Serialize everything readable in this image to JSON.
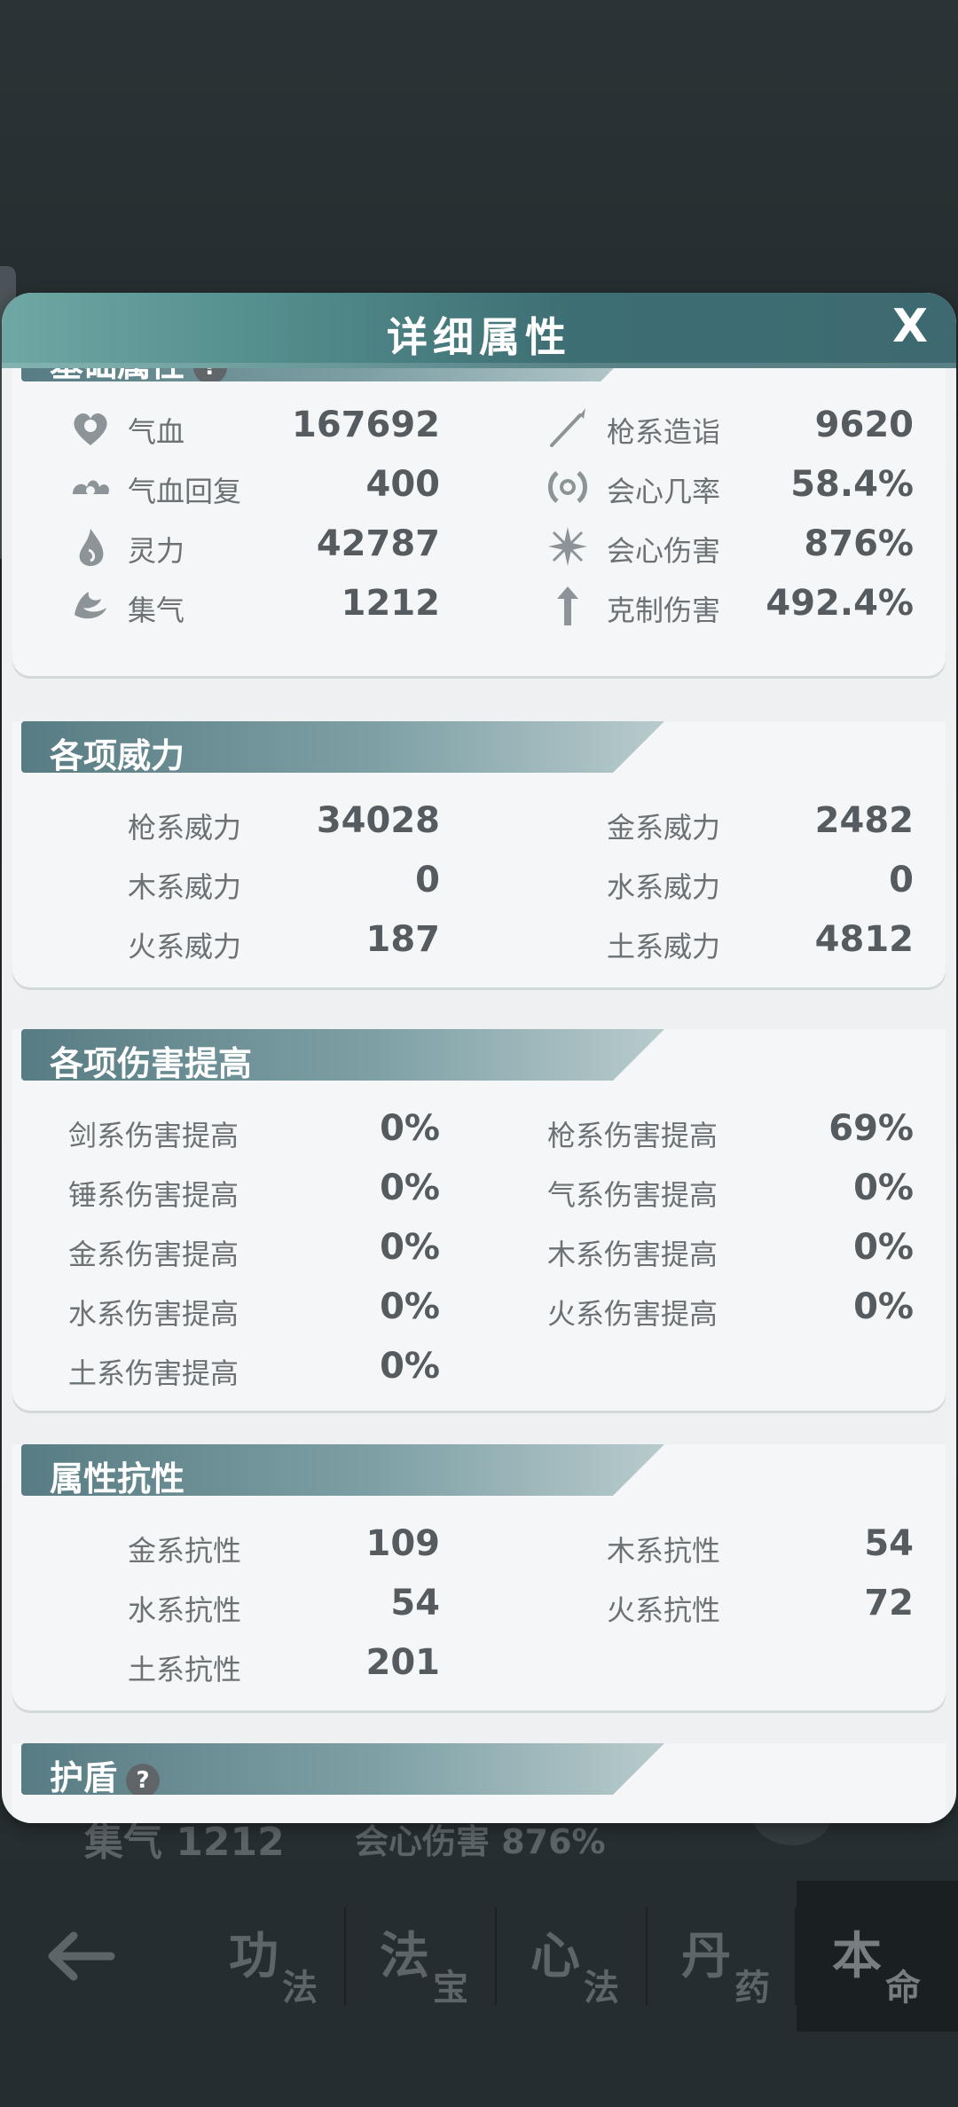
{
  "dialog": {
    "title": "详细属性",
    "close_label": "X"
  },
  "background": {
    "row_label": "集气 1212",
    "row_label2": "会心伤害 876%"
  },
  "basic": {
    "header": "基础属性",
    "help": "?",
    "left": [
      {
        "icon": "blood-icon",
        "label": "气血",
        "value": "167692"
      },
      {
        "icon": "blood-regen-icon",
        "label": "气血回复",
        "value": "400"
      },
      {
        "icon": "spirit-icon",
        "label": "灵力",
        "value": "42787"
      },
      {
        "icon": "qi-icon",
        "label": "集气",
        "value": "1212"
      }
    ],
    "right": [
      {
        "icon": "spear-icon",
        "label": "枪系造诣",
        "value": "9620"
      },
      {
        "icon": "crit-rate-icon",
        "label": "会心几率",
        "value": "58.4%"
      },
      {
        "icon": "crit-damage-icon",
        "label": "会心伤害",
        "value": "876%"
      },
      {
        "icon": "counter-damage-icon",
        "label": "克制伤害",
        "value": "492.4%"
      }
    ]
  },
  "power": {
    "header": "各项威力",
    "left": [
      {
        "label": "枪系威力",
        "value": "34028"
      },
      {
        "label": "木系威力",
        "value": "0"
      },
      {
        "label": "火系威力",
        "value": "187"
      }
    ],
    "right": [
      {
        "label": "金系威力",
        "value": "2482"
      },
      {
        "label": "水系威力",
        "value": "0"
      },
      {
        "label": "土系威力",
        "value": "4812"
      }
    ]
  },
  "damage": {
    "header": "各项伤害提高",
    "left": [
      {
        "label": "剑系伤害提高",
        "value": "0%"
      },
      {
        "label": "锤系伤害提高",
        "value": "0%"
      },
      {
        "label": "金系伤害提高",
        "value": "0%"
      },
      {
        "label": "水系伤害提高",
        "value": "0%"
      },
      {
        "label": "土系伤害提高",
        "value": "0%"
      }
    ],
    "right": [
      {
        "label": "枪系伤害提高",
        "value": "69%"
      },
      {
        "label": "气系伤害提高",
        "value": "0%"
      },
      {
        "label": "木系伤害提高",
        "value": "0%"
      },
      {
        "label": "火系伤害提高",
        "value": "0%"
      }
    ]
  },
  "resist": {
    "header": "属性抗性",
    "left": [
      {
        "label": "金系抗性",
        "value": "109"
      },
      {
        "label": "水系抗性",
        "value": "54"
      },
      {
        "label": "土系抗性",
        "value": "201"
      }
    ],
    "right": [
      {
        "label": "木系抗性",
        "value": "54"
      },
      {
        "label": "火系抗性",
        "value": "72"
      }
    ]
  },
  "shield": {
    "header": "护盾",
    "help": "?"
  },
  "nav": {
    "back": "back-arrow-icon",
    "tabs": [
      {
        "big": "功",
        "small": "法"
      },
      {
        "big": "法",
        "small": "宝"
      },
      {
        "big": "心",
        "small": "法"
      },
      {
        "big": "丹",
        "small": "药"
      },
      {
        "big": "本",
        "small": "命"
      }
    ]
  }
}
